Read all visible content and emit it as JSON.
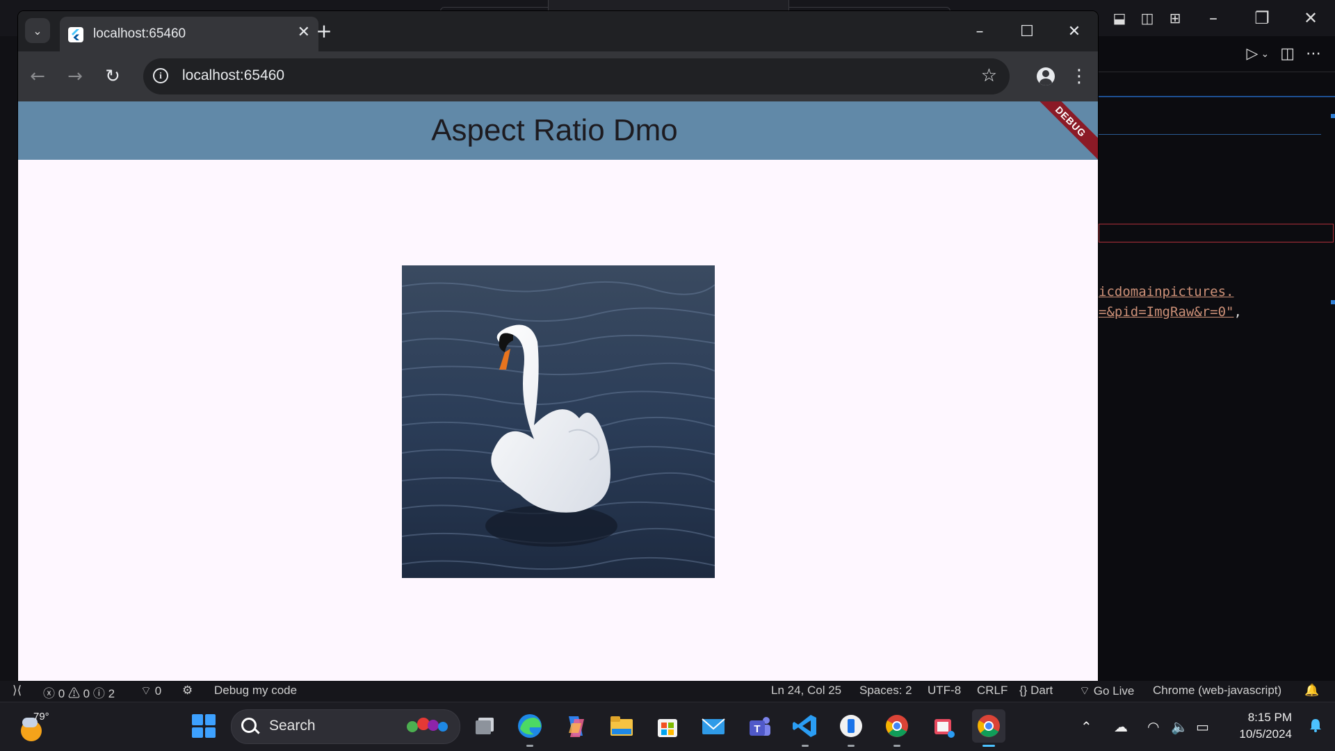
{
  "vscode": {
    "code_lines": [
      {
        "text": "icdomainpictures.",
        "tail": ""
      },
      {
        "text": "=&pid=ImgRaw&r=0\"",
        "tail": ","
      }
    ],
    "statusbar": {
      "errors": "0",
      "warnings": "0",
      "infos": "2",
      "ports": "0",
      "debug_label": "Debug my code",
      "position": "Ln 24, Col 25",
      "spaces": "Spaces: 2",
      "encoding": "UTF-8",
      "eol": "CRLF",
      "language": "Dart",
      "go_live": "Go Live",
      "device": "Chrome (web-javascript)"
    }
  },
  "chrome": {
    "tab_title": "localhost:65460",
    "url": "localhost:65460"
  },
  "app": {
    "title": "Aspect Ratio Dmo",
    "debug_banner": "DEBUG"
  },
  "taskbar": {
    "temperature": "79°",
    "search_placeholder": "Search",
    "time": "8:15 PM",
    "date": "10/5/2024"
  },
  "colors": {
    "appbar": "#6189a8",
    "page_bg": "#fef7ff",
    "debug_banner": "#8b1a26",
    "accent": "#4cc2ff"
  }
}
